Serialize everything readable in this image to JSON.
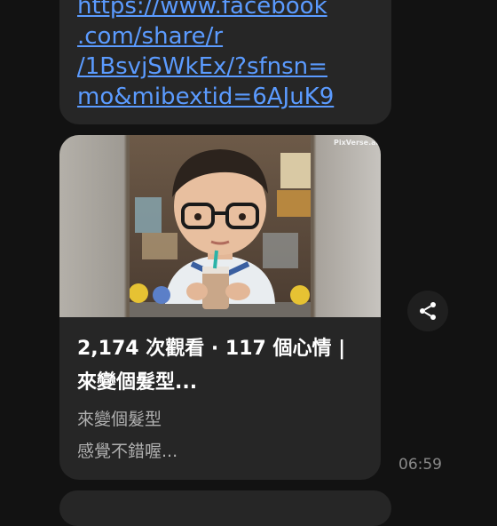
{
  "previous_message": {
    "link_lines": [
      "https://www.facebook",
      ".com/share/r",
      "/1BsvjSWkEx/?sfnsn=",
      "mo&mibextid=6AJuK9"
    ]
  },
  "link_preview": {
    "image_watermark": "PixVerse.ai",
    "title_line1": "2,174 次觀看 · 117 個心情 |",
    "title_line2": "來變個髮型...",
    "description_line1": "來變個髮型",
    "description_line2": "感覺不錯喔..."
  },
  "timestamp": "06:59",
  "icons": {
    "share": "share-icon"
  }
}
